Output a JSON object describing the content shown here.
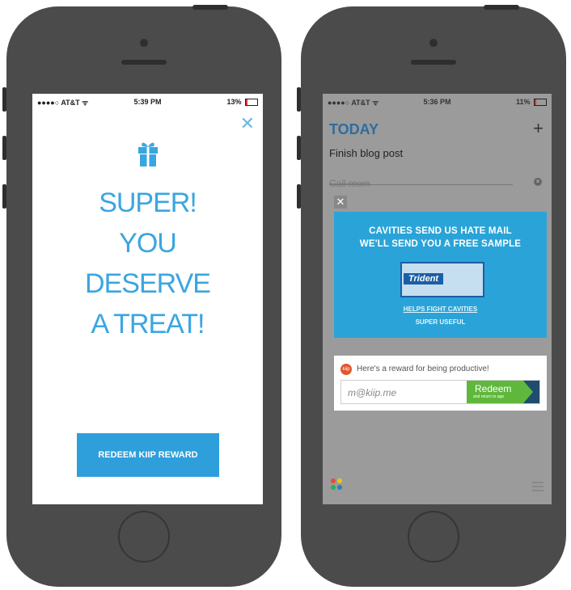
{
  "left_phone": {
    "status": {
      "carrier": "●●●●○ AT&T ᯤ",
      "time": "5:39 PM",
      "battery": "13%"
    },
    "close_glyph": "✕",
    "headline_lines": [
      "SUPER!",
      "YOU",
      "DESERVE",
      "A TREAT!"
    ],
    "redeem_label": "REDEEM KIIP REWARD"
  },
  "right_phone": {
    "status": {
      "carrier": "●●●●○ AT&T ᯤ",
      "time": "5:36 PM",
      "battery": "11%"
    },
    "title": "TODAY",
    "add_glyph": "+",
    "task_1": "Finish blog post",
    "task_2": "Call mom",
    "ad": {
      "close_glyph": "✕",
      "headline_1": "CAVITIES SEND US HATE MAIL",
      "headline_2": "WE'LL SEND YOU A FREE SAMPLE",
      "brand": "Trident",
      "sub_1": "HELPS FIGHT CAVITIES",
      "sub_2": "SUPER USEFUL"
    },
    "reward": {
      "logo": "kiip",
      "message": "Here's a reward for being productive!",
      "email_value": "m@kiip.me",
      "redeem_label": "Redeem",
      "redeem_sub": "and return to app"
    }
  },
  "colors": {
    "accent_blue": "#3aa6e0",
    "ad_blue": "#2aa4d8",
    "redeem_green": "#5fb83c",
    "kiip_orange": "#e0572f"
  }
}
